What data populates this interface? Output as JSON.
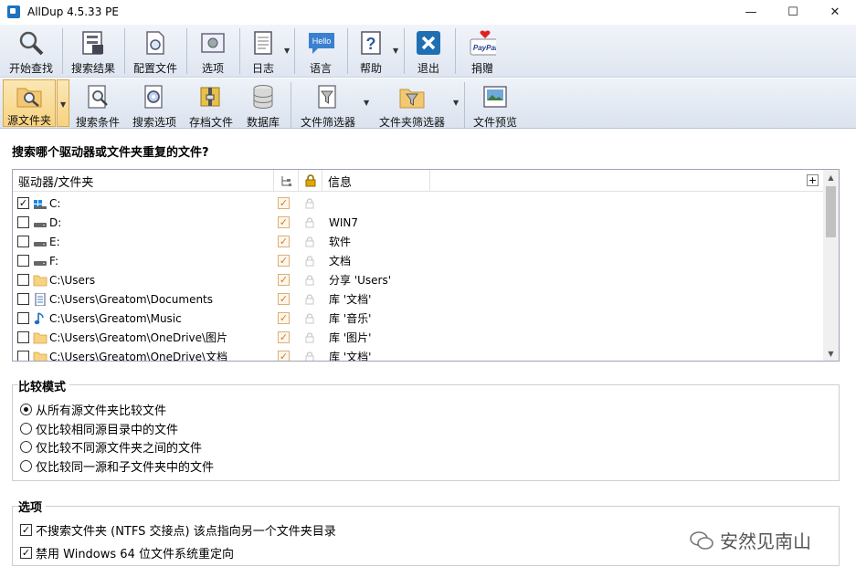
{
  "window": {
    "title": "AllDup 4.5.33 PE",
    "minimize": "—",
    "maximize": "☐",
    "close": "✕"
  },
  "toolbar_main": [
    {
      "label": "开始查找",
      "icon": "magnifier-icon"
    },
    {
      "label": "搜索结果",
      "icon": "results-icon"
    },
    {
      "label": "配置文件",
      "icon": "profile-icon"
    },
    {
      "label": "选项",
      "icon": "options-icon"
    },
    {
      "label": "日志",
      "icon": "log-icon"
    },
    {
      "label": "语言",
      "icon": "language-icon",
      "badge": "Hello"
    },
    {
      "label": "帮助",
      "icon": "help-icon"
    },
    {
      "label": "退出",
      "icon": "exit-icon"
    },
    {
      "label": "捐赠",
      "icon": "paypal-icon",
      "badge": "PayPal"
    }
  ],
  "toolbar_sub": [
    {
      "label": "源文件夹",
      "icon": "source-folder-icon",
      "active": true
    },
    {
      "label": "搜索条件",
      "icon": "criteria-icon"
    },
    {
      "label": "搜索选项",
      "icon": "search-options-icon"
    },
    {
      "label": "存档文件",
      "icon": "archive-icon"
    },
    {
      "label": "数据库",
      "icon": "database-icon"
    },
    {
      "label": "文件筛选器",
      "icon": "file-filter-icon"
    },
    {
      "label": "文件夹筛选器",
      "icon": "folder-filter-icon"
    },
    {
      "label": "文件预览",
      "icon": "preview-icon"
    }
  ],
  "source": {
    "question": "搜索哪个驱动器或文件夹重复的文件?",
    "col_drive": "驱动器/文件夹",
    "col_info": "信息",
    "add_button": "+",
    "rows": [
      {
        "checked": true,
        "icon": "windows-drive-icon",
        "path": "C:",
        "info": ""
      },
      {
        "checked": false,
        "icon": "drive-icon",
        "path": "D:",
        "info": "WIN7"
      },
      {
        "checked": false,
        "icon": "drive-icon",
        "path": "E:",
        "info": "软件"
      },
      {
        "checked": false,
        "icon": "drive-icon",
        "path": "F:",
        "info": "文档"
      },
      {
        "checked": false,
        "icon": "folder-icon",
        "path": "C:\\Users",
        "info": "分享 'Users'"
      },
      {
        "checked": false,
        "icon": "document-icon",
        "path": "C:\\Users\\Greatom\\Documents",
        "info": "库 '文档'"
      },
      {
        "checked": false,
        "icon": "music-icon",
        "path": "C:\\Users\\Greatom\\Music",
        "info": "库 '音乐'"
      },
      {
        "checked": false,
        "icon": "folder-icon",
        "path": "C:\\Users\\Greatom\\OneDrive\\图片",
        "info": "库 '图片'"
      },
      {
        "checked": false,
        "icon": "folder-icon",
        "path": "C:\\Users\\Greatom\\OneDrive\\文档",
        "info": "库 '文档'"
      }
    ]
  },
  "compare_mode": {
    "title": "比较模式",
    "options": [
      {
        "label": "从所有源文件夹比较文件",
        "selected": true
      },
      {
        "label": "仅比较相同源目录中的文件",
        "selected": false
      },
      {
        "label": "仅比较不同源文件夹之间的文件",
        "selected": false
      },
      {
        "label": "仅比较同一源和子文件夹中的文件",
        "selected": false
      }
    ]
  },
  "options": {
    "title": "选项",
    "items": [
      {
        "label": "不搜索文件夹 (NTFS 交接点) 该点指向另一个文件夹目录",
        "checked": true
      },
      {
        "label": "禁用 Windows 64 位文件系统重定向",
        "checked": true
      }
    ]
  },
  "watermark": {
    "text": "安然见南山"
  },
  "colors": {
    "toolbar_top": "#f1f4f9",
    "toolbar_bottom": "#dfe6f1",
    "active_button": "#f7d37f",
    "check_orange": "#d07b2a"
  }
}
